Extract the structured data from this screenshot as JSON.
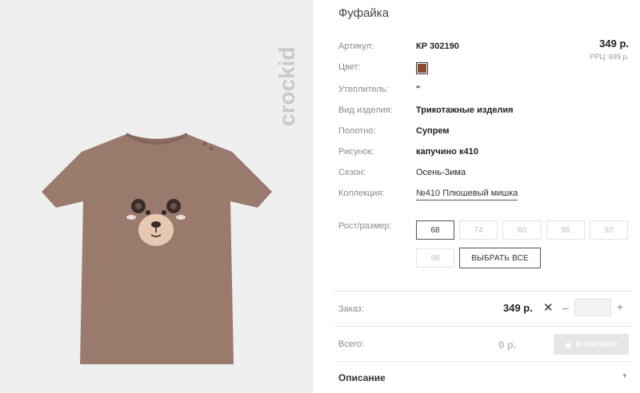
{
  "brand": {
    "text": "crockid"
  },
  "product": {
    "title": "Фуфайка",
    "price": "349 р.",
    "rrp": "РРЦ: 699 р.",
    "color_hex": "#8a4a34",
    "attributes": [
      {
        "label": "Артикул:",
        "value": "КР 302190"
      },
      {
        "label": "Цвет:",
        "value": ""
      },
      {
        "label": "Утеплитель:",
        "value": "\""
      },
      {
        "label": "Вид изделия:",
        "value": "Трикотажные изделия"
      },
      {
        "label": "Полотно:",
        "value": "Супрем"
      },
      {
        "label": "Рисунок:",
        "value": "капучино к410"
      },
      {
        "label": "Сезон:",
        "value": "Осень-Зима"
      },
      {
        "label": "Коллекция:",
        "value": "№410 Плюшевый мишка"
      }
    ]
  },
  "sizes": {
    "label": "Рост/размер:",
    "options": [
      "68",
      "74",
      "80",
      "86",
      "92",
      "98"
    ],
    "selected": "68",
    "select_all": "ВЫБРАТЬ ВСЕ"
  },
  "order": {
    "label": "Заказ:",
    "price": "349 р.",
    "times": "✕",
    "minus": "–",
    "plus": "+",
    "quantity": ""
  },
  "total": {
    "label": "Всего:",
    "value": "0 р.",
    "cart_button": "В КОРЗИНУ"
  },
  "description": {
    "label": "Описание",
    "chevron": "▼"
  },
  "colors": {
    "shirt": "#9b7a6e",
    "photo_bg": "#efefef"
  }
}
